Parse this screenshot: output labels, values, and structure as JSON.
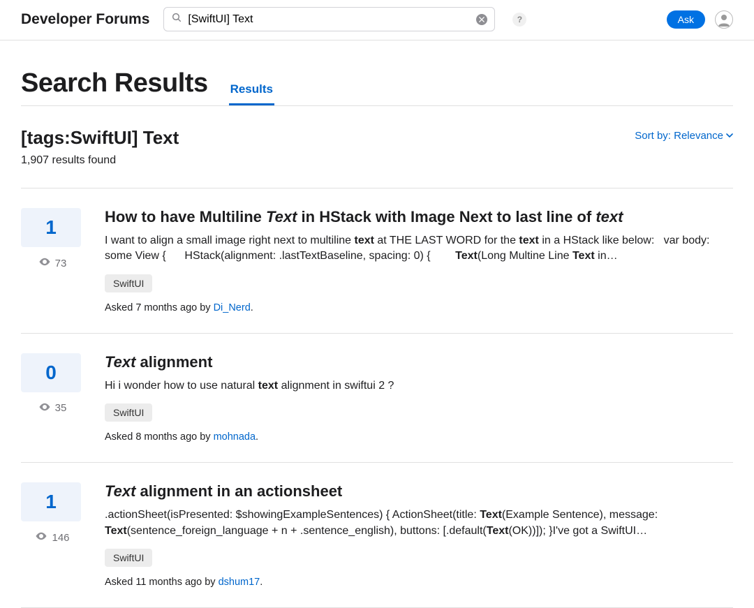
{
  "header": {
    "brand": "Developer Forums",
    "search_value": "[SwiftUI] Text",
    "help_label": "?",
    "ask_label": "Ask"
  },
  "page": {
    "title": "Search Results",
    "tab_label": "Results",
    "query_display": "[tags:SwiftUI] Text",
    "results_count": "1,907 results found",
    "sort_label": "Sort by: Relevance"
  },
  "results": [
    {
      "score": "1",
      "views": "73",
      "title_html": "How to have Multiline <em>Text</em> in HStack with Image Next to last line of <em>text</em>",
      "snippet_html": "I want to align a small image right next to multiline <b>text</b> at THE LAST WORD for the <b>text</b> in a HStack like below: &nbsp;&nbsp;var body: some View { &nbsp;&nbsp;&nbsp;&nbsp; HStack(alignment: .lastTextBaseline, spacing: 0) { &nbsp;&nbsp;&nbsp;&nbsp;&nbsp;&nbsp; <b>Text</b>(Long Multine Line <b>Text</b> in…",
      "tag": "SwiftUI",
      "asked_prefix": "Asked 7 months ago by ",
      "author": "Di_Nerd"
    },
    {
      "score": "0",
      "views": "35",
      "title_html": "<em>Text</em> alignment",
      "snippet_html": "Hi i wonder how to use natural <b>text</b> alignment in swiftui 2 ?",
      "tag": "SwiftUI",
      "asked_prefix": "Asked 8 months ago by ",
      "author": "mohnada"
    },
    {
      "score": "1",
      "views": "146",
      "title_html": "<em>Text</em> alignment in an actionsheet",
      "snippet_html": ".actionSheet(isPresented: $showingExampleSentences) { ActionSheet(title: <b>Text</b>(Example Sentence), message: <b>Text</b>(sentence_foreign_language + n + .sentence_english), buttons: [.default(<b>Text</b>(OK))]); }I've got a SwiftUI…",
      "tag": "SwiftUI",
      "asked_prefix": "Asked 11 months ago by ",
      "author": "dshum17"
    }
  ]
}
